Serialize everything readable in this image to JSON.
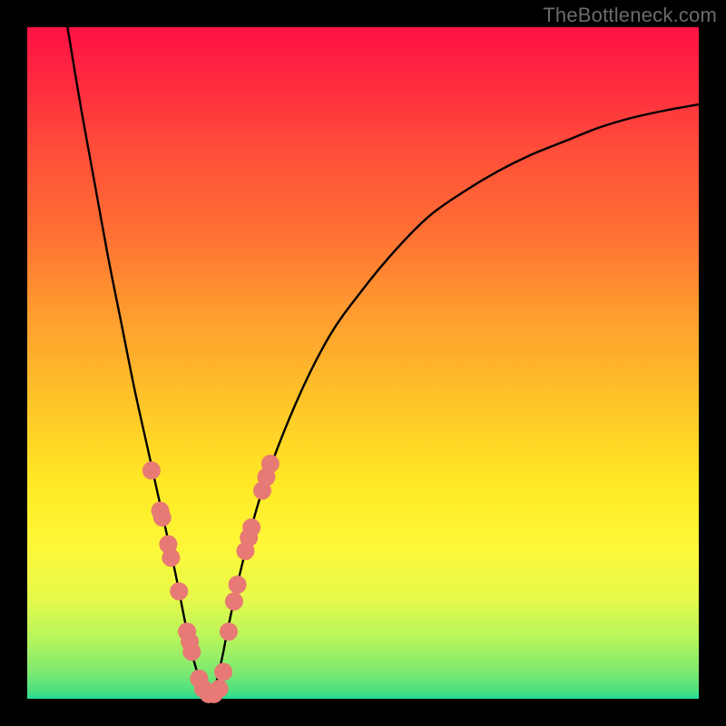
{
  "watermark": "TheBottleneck.com",
  "chart_data": {
    "type": "line",
    "title": "",
    "xlabel": "",
    "ylabel": "",
    "xlim": [
      0,
      100
    ],
    "ylim": [
      0,
      100
    ],
    "curve": {
      "name": "bottleneck-curve",
      "minimum_x": 27,
      "x": [
        6,
        8,
        10,
        12,
        14,
        16,
        18,
        20,
        22,
        24,
        25,
        26,
        27,
        28,
        29,
        30,
        32,
        35,
        40,
        45,
        50,
        55,
        60,
        65,
        70,
        75,
        80,
        85,
        90,
        95,
        100
      ],
      "y": [
        100,
        88,
        77,
        66,
        56,
        46,
        37,
        28,
        19,
        9,
        5,
        2,
        0.5,
        2,
        6,
        11,
        20,
        31,
        44,
        54,
        61,
        67,
        72,
        75.5,
        78.5,
        81,
        83,
        85,
        86.5,
        87.6,
        88.5
      ]
    },
    "highlight_points": {
      "name": "sample-dots",
      "color": "#e77a74",
      "points": [
        {
          "x": 18.5,
          "y": 34
        },
        {
          "x": 19.8,
          "y": 28
        },
        {
          "x": 20.1,
          "y": 27
        },
        {
          "x": 21.0,
          "y": 23
        },
        {
          "x": 21.4,
          "y": 21
        },
        {
          "x": 22.6,
          "y": 16
        },
        {
          "x": 23.8,
          "y": 10
        },
        {
          "x": 24.2,
          "y": 8.5
        },
        {
          "x": 24.5,
          "y": 7
        },
        {
          "x": 25.6,
          "y": 3
        },
        {
          "x": 26.2,
          "y": 1.5
        },
        {
          "x": 27.0,
          "y": 0.7
        },
        {
          "x": 27.8,
          "y": 0.7
        },
        {
          "x": 28.6,
          "y": 1.5
        },
        {
          "x": 29.2,
          "y": 4
        },
        {
          "x": 30.0,
          "y": 10
        },
        {
          "x": 30.8,
          "y": 14.5
        },
        {
          "x": 31.3,
          "y": 17
        },
        {
          "x": 32.5,
          "y": 22
        },
        {
          "x": 33.0,
          "y": 24
        },
        {
          "x": 33.4,
          "y": 25.5
        },
        {
          "x": 35.0,
          "y": 31
        },
        {
          "x": 35.6,
          "y": 33
        },
        {
          "x": 36.2,
          "y": 35
        }
      ]
    }
  }
}
